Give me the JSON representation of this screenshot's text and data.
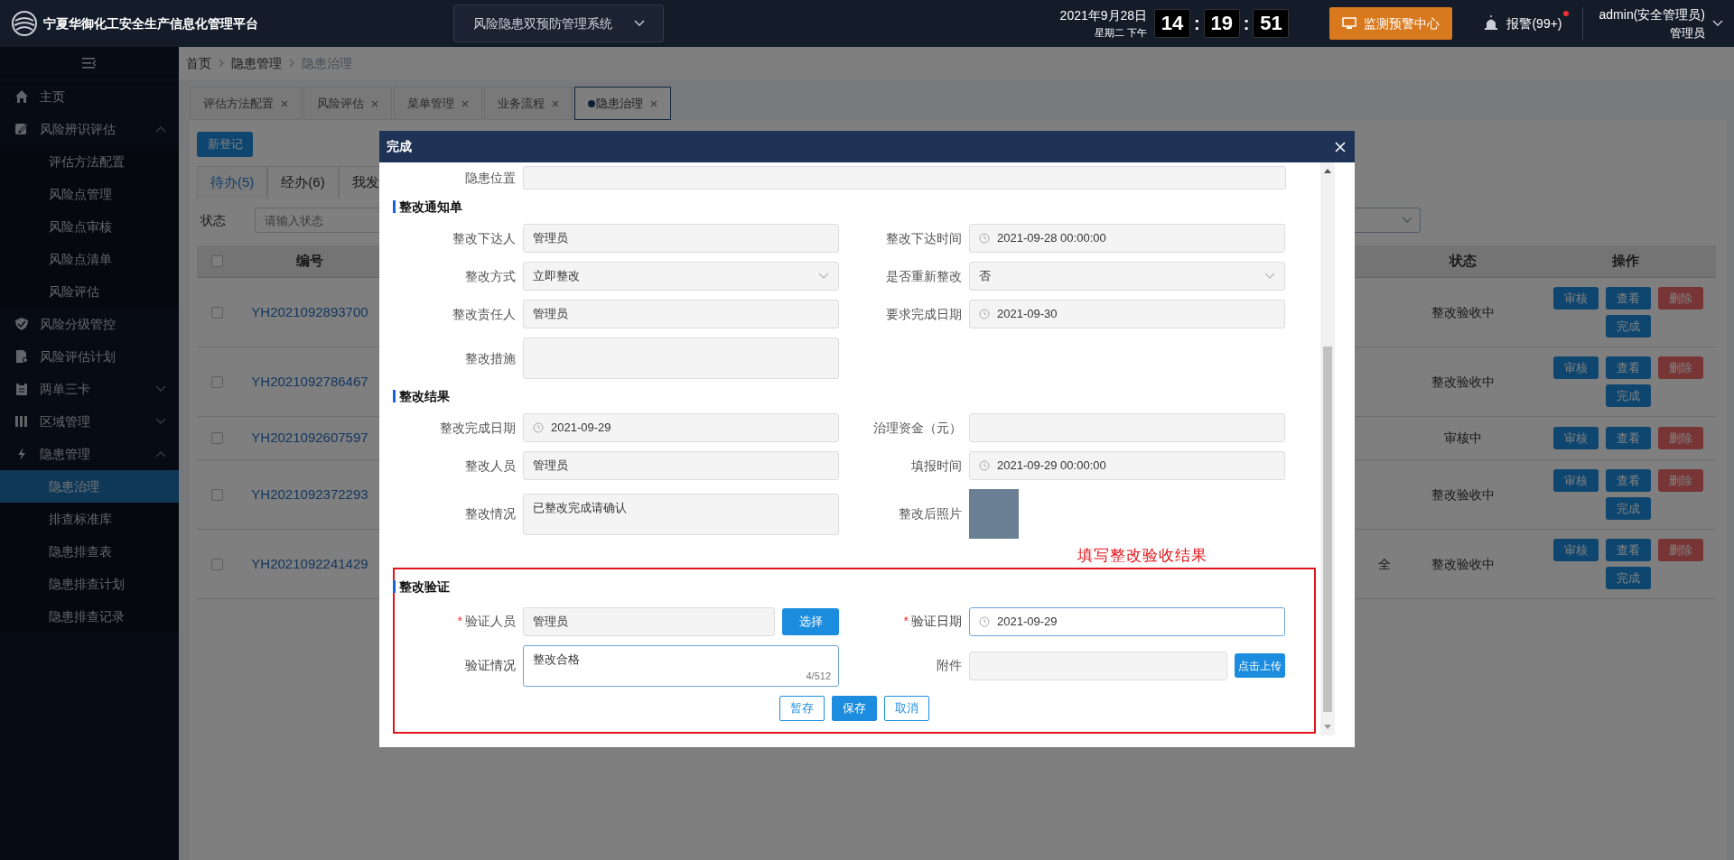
{
  "header": {
    "title": "宁夏华御化工安全生产信息化管理平台",
    "system_selector": "风险隐患双预防管理系统",
    "date": "2021年9月28日",
    "weekday_time": "星期二 下午",
    "clock": [
      {
        "kind": "digits",
        "text": "14"
      },
      {
        "kind": "separator",
        "text": ":"
      },
      {
        "kind": "digits",
        "text": "19"
      },
      {
        "kind": "separator",
        "text": ":"
      },
      {
        "kind": "digits",
        "text": "51"
      }
    ],
    "monitor_button": "监测预警中心",
    "alarm": "报警(99+)",
    "alarm_unread": true,
    "user": "admin(安全管理员)",
    "role": "管理员"
  },
  "sidebar": {
    "items": [
      {
        "label": "主页",
        "selected": false
      },
      {
        "label": "风险辨识评估",
        "selected": false,
        "expanded": true,
        "children": [
          {
            "label": "评估方法配置",
            "selected": false
          },
          {
            "label": "风险点管理",
            "selected": false
          },
          {
            "label": "风险点审核",
            "selected": false
          },
          {
            "label": "风险点清单",
            "selected": false
          },
          {
            "label": "风险评估",
            "selected": false
          }
        ]
      },
      {
        "label": "风险分级管控",
        "selected": false
      },
      {
        "label": "风险评估计划",
        "selected": false
      },
      {
        "label": "两单三卡",
        "selected": false,
        "expanded": false
      },
      {
        "label": "区域管理",
        "selected": false,
        "expanded": false
      },
      {
        "label": "隐患管理",
        "selected": false,
        "expanded": true,
        "children": [
          {
            "label": "隐患治理",
            "selected": true
          },
          {
            "label": "排查标准库",
            "selected": false
          },
          {
            "label": "隐患排查表",
            "selected": false
          },
          {
            "label": "隐患排查计划",
            "selected": false
          },
          {
            "label": "隐患排查记录",
            "selected": false
          }
        ]
      }
    ]
  },
  "breadcrumb": [
    "首页",
    "隐患管理",
    "隐患治理"
  ],
  "page_tabs": [
    {
      "label": "评估方法配置",
      "selected": false
    },
    {
      "label": "风险评估",
      "selected": false
    },
    {
      "label": "菜单管理",
      "selected": false
    },
    {
      "label": "业务流程",
      "selected": false
    },
    {
      "label": "隐患治理",
      "selected": true
    }
  ],
  "new_button": "新登记",
  "sub_tabs": [
    {
      "label": "待办(5)",
      "selected": true
    },
    {
      "label": "经办(6)",
      "selected": false
    },
    {
      "label": "我发",
      "selected": false
    }
  ],
  "filter": {
    "label": "状态",
    "placeholder": "请输入状态"
  },
  "table": {
    "columns": [
      "编号",
      "状态",
      "操作"
    ],
    "header_checked": false,
    "rows": [
      {
        "checked": false,
        "id": "YH2021092893700",
        "status": "整改验收中",
        "actions": [
          {
            "label": "审核",
            "kind": "primary"
          },
          {
            "label": "查看",
            "kind": "primary"
          },
          {
            "label": "删除",
            "kind": "danger"
          },
          {
            "label": "完成",
            "kind": "primary"
          }
        ]
      },
      {
        "checked": false,
        "id": "YH2021092786467",
        "status": "整改验收中",
        "actions": [
          {
            "label": "审核",
            "kind": "primary"
          },
          {
            "label": "查看",
            "kind": "primary"
          },
          {
            "label": "删除",
            "kind": "danger"
          },
          {
            "label": "完成",
            "kind": "primary"
          }
        ]
      },
      {
        "checked": false,
        "id": "YH2021092607597",
        "status": "审核中",
        "actions": [
          {
            "label": "审核",
            "kind": "primary"
          },
          {
            "label": "查看",
            "kind": "primary"
          },
          {
            "label": "删除",
            "kind": "danger"
          }
        ]
      },
      {
        "checked": false,
        "id": "YH2021092372293",
        "status": "整改验收中",
        "actions": [
          {
            "label": "审核",
            "kind": "primary"
          },
          {
            "label": "查看",
            "kind": "primary"
          },
          {
            "label": "删除",
            "kind": "danger"
          },
          {
            "label": "完成",
            "kind": "primary"
          }
        ]
      },
      {
        "checked": false,
        "id": "YH2021092241429",
        "column_3": "全",
        "status": "整改验收中",
        "actions": [
          {
            "label": "审核",
            "kind": "primary"
          },
          {
            "label": "查看",
            "kind": "primary"
          },
          {
            "label": "删除",
            "kind": "danger"
          },
          {
            "label": "完成",
            "kind": "primary"
          }
        ]
      }
    ]
  },
  "modal": {
    "title": "完成",
    "location_field": {
      "label": "隐患位置"
    },
    "sections": [
      {
        "heading": "整改通知单",
        "highlighted": false,
        "rows": [
          [
            {
              "label": "整改下达人",
              "kind": "text",
              "value": "管理员",
              "editable": false
            },
            {
              "label": "整改下达时间",
              "kind": "date",
              "value": "2021-09-28 00:00:00",
              "editable": false
            }
          ],
          [
            {
              "label": "整改方式",
              "kind": "select",
              "value": "立即整改",
              "editable": false
            },
            {
              "label": "是否重新整改",
              "kind": "select",
              "value": "否",
              "editable": false
            }
          ],
          [
            {
              "label": "整改责任人",
              "kind": "text",
              "value": "管理员",
              "editable": false
            },
            {
              "label": "要求完成日期",
              "kind": "date",
              "value": "2021-09-30",
              "editable": false
            }
          ],
          [
            {
              "label": "整改措施",
              "kind": "textarea",
              "editable": false
            }
          ]
        ]
      },
      {
        "heading": "整改结果",
        "highlighted": false,
        "rows": [
          [
            {
              "label": "整改完成日期",
              "kind": "date",
              "value": "2021-09-29",
              "editable": false
            },
            {
              "label": "治理资金（元）",
              "kind": "text",
              "editable": false
            }
          ],
          [
            {
              "label": "整改人员",
              "kind": "text",
              "value": "管理员",
              "editable": false
            },
            {
              "label": "填报时间",
              "kind": "date",
              "value": "2021-09-29 00:00:00",
              "editable": false
            }
          ],
          [
            {
              "label": "整改情况",
              "kind": "textarea",
              "value": "已整改完成请确认",
              "editable": false
            },
            {
              "label": "整改后照片",
              "kind": "photo"
            }
          ]
        ]
      },
      {
        "heading": "整改验证",
        "highlighted": true,
        "annotation": "填写整改验收结果",
        "rows": [
          [
            {
              "label": "验证人员",
              "kind": "picker",
              "value": "管理员",
              "button": "选择",
              "required_mark": "*",
              "editable": false
            },
            {
              "label": "验证日期",
              "kind": "date",
              "value": "2021-09-29",
              "required_mark": "*",
              "editable": true
            }
          ],
          [
            {
              "label": "验证情况",
              "kind": "textarea",
              "value": "整改合格",
              "counter": "4/512",
              "editable": true
            },
            {
              "label": "附件",
              "kind": "upload",
              "button": "点击上传",
              "editable": false
            }
          ]
        ],
        "buttons": [
          {
            "label": "暂存",
            "kind": "outline"
          },
          {
            "label": "保存",
            "kind": "primary"
          },
          {
            "label": "取消",
            "kind": "outline"
          }
        ]
      }
    ]
  }
}
